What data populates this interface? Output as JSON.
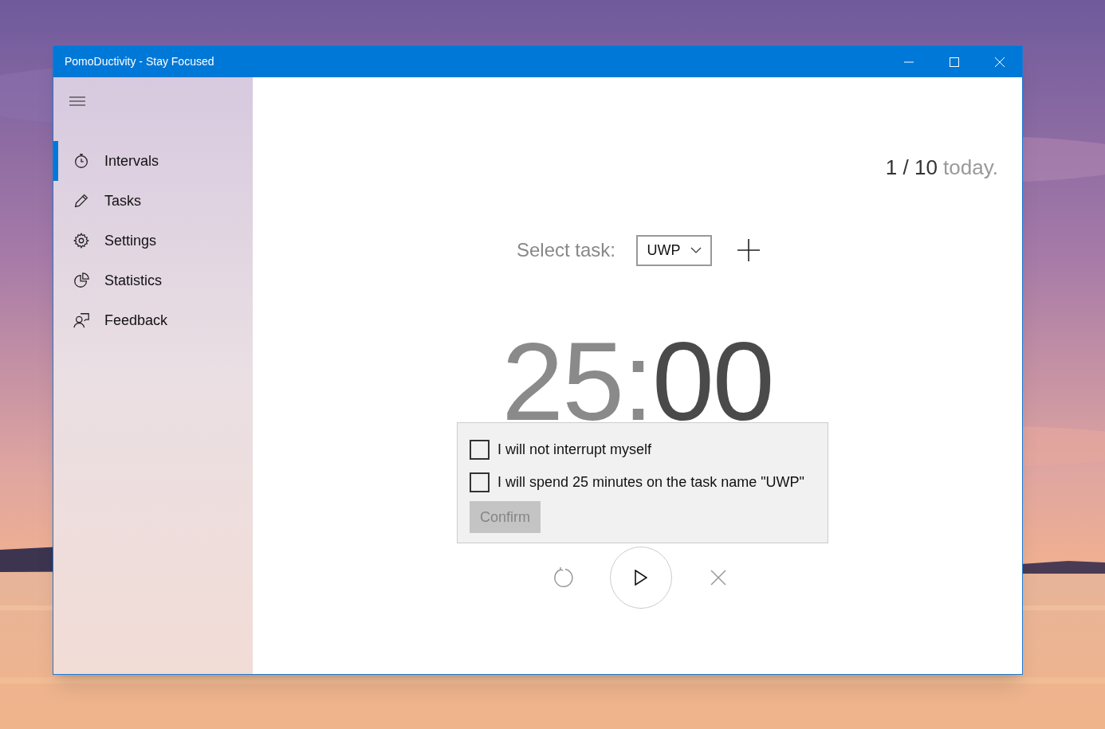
{
  "window": {
    "title": "PomoDuctivity - Stay Focused"
  },
  "sidebar": {
    "items": [
      {
        "label": "Intervals",
        "selected": true
      },
      {
        "label": "Tasks",
        "selected": false
      },
      {
        "label": "Settings",
        "selected": false
      },
      {
        "label": "Statistics",
        "selected": false
      },
      {
        "label": "Feedback",
        "selected": false
      }
    ]
  },
  "counter": {
    "done": "1 / 10",
    "suffix": "today."
  },
  "task_select": {
    "label": "Select task:",
    "value": "UWP"
  },
  "timer": {
    "minutes": "25",
    "separator": ":",
    "seconds": "00"
  },
  "confirm_popup": {
    "checks": [
      {
        "label": "I will not interrupt myself",
        "checked": false
      },
      {
        "label": "I will spend 25 minutes on the task name \"UWP\"",
        "checked": false
      }
    ],
    "button": {
      "label": "Confirm",
      "disabled": true
    }
  }
}
